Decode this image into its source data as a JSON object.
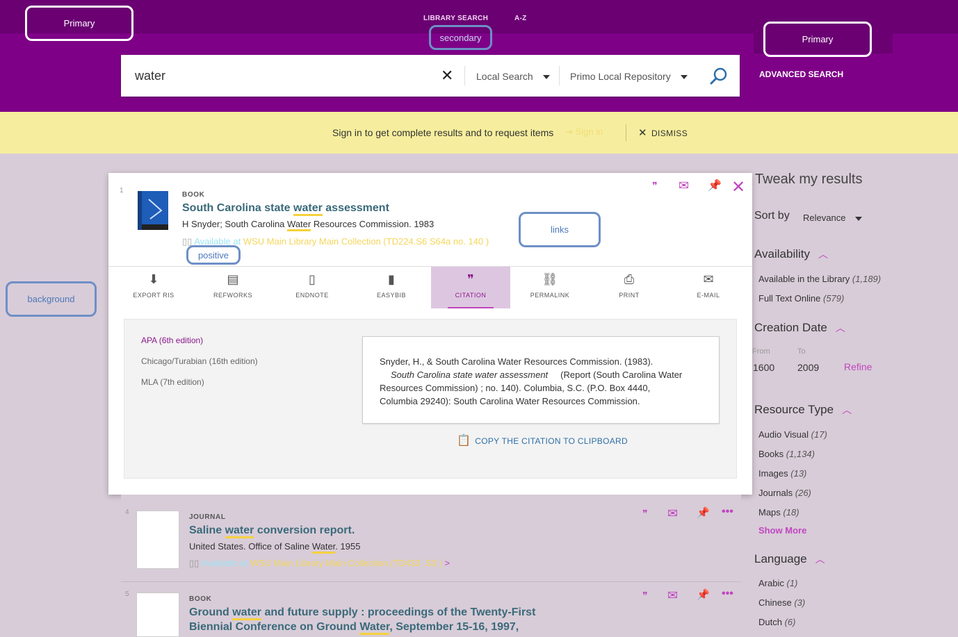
{
  "header": {
    "top_links": [
      "LIBRARY SEARCH",
      "A-Z"
    ],
    "advanced_search": "ADVANCED SEARCH"
  },
  "callouts": {
    "primary_left": "Primary",
    "secondary": "secondary",
    "primary_right": "Primary",
    "links": "links",
    "positive": "positive",
    "background": "background"
  },
  "search": {
    "query": "water",
    "scope": "Local Search",
    "tab": "Primo Local Repository"
  },
  "banner": {
    "text": "Sign in to get complete results and to request items",
    "signin": "Sign in",
    "dismiss": "DISMISS"
  },
  "record1": {
    "num": "1",
    "type": "BOOK",
    "title_pre": "South Carolina state ",
    "title_hl": "water",
    "title_post": " assessment",
    "meta_pre": "H Snyder; South Carolina ",
    "meta_hl": "Water",
    "meta_post": " Resources Commission. 1983",
    "avail_a": "Available at",
    "avail_b": "WSU Main Library Main Collection (TD224.S6 S64a no. 140 )"
  },
  "toolbar": [
    {
      "label": "EXPORT RIS",
      "icon": "export-icon"
    },
    {
      "label": "REFWORKS",
      "icon": "document-icon"
    },
    {
      "label": "ENDNOTE",
      "icon": "file-icon"
    },
    {
      "label": "EASYBIB",
      "icon": "easybib-icon"
    },
    {
      "label": "CITATION",
      "icon": "quote-icon",
      "active": true
    },
    {
      "label": "PERMALINK",
      "icon": "link-icon"
    },
    {
      "label": "PRINT",
      "icon": "print-icon"
    },
    {
      "label": "E-MAIL",
      "icon": "mail-icon"
    }
  ],
  "citation": {
    "styles": [
      "APA (6th edition)",
      "Chicago/Turabian (16th edition)",
      "MLA (7th edition)"
    ],
    "line1": "Snyder, H., & South Carolina Water Resources Commission. (1983).",
    "title_italic": "South Carolina state water assessment",
    "line2_post": "(Report (South Carolina Water",
    "line3": "Resources Commission) ; no. 140). Columbia, S.C. (P.O. Box 4440,",
    "line4": "Columbia 29240): South Carolina Water Resources Commission.",
    "copy": "COPY THE CITATION TO CLIPBOARD"
  },
  "record4": {
    "num": "4",
    "type": "JOURNAL",
    "title_pre": "Saline ",
    "title_hl": "water",
    "title_post": " conversion report.",
    "meta_pre": "United States. Office of Saline ",
    "meta_hl": "Water",
    "meta_post": ". 1955",
    "avail_a": "Available at",
    "avail_b": "WSU Main Library Main Collection (TD433 .S3 )",
    "avail_c": ">"
  },
  "record5": {
    "num": "5",
    "type": "BOOK",
    "t1_pre": "Ground ",
    "t1_hl": "water",
    "t1_post": " and future supply : proceedings of the Twenty-First",
    "t2_pre": "Biennial Conference on Ground ",
    "t2_hl": "Water",
    "t2_post": ", September 15-16, 1997,"
  },
  "sidebar": {
    "title": "Tweak my results",
    "sort_label": "Sort by",
    "sort_value": "Relevance",
    "availability": {
      "heading": "Availability",
      "items": [
        {
          "label": "Available in the Library",
          "count": "(1,189)"
        },
        {
          "label": "Full Text Online",
          "count": "(579)"
        }
      ]
    },
    "creation": {
      "heading": "Creation Date",
      "from_label": "From",
      "to_label": "To",
      "from_value": "1600",
      "to_value": "2009",
      "refine": "Refine"
    },
    "resource": {
      "heading": "Resource Type",
      "items": [
        {
          "label": "Audio Visual",
          "count": "(17)"
        },
        {
          "label": "Books",
          "count": "(1,134)"
        },
        {
          "label": "Images",
          "count": "(13)"
        },
        {
          "label": "Journals",
          "count": "(26)"
        },
        {
          "label": "Maps",
          "count": "(18)"
        }
      ],
      "show_more": "Show More"
    },
    "language": {
      "heading": "Language",
      "items": [
        {
          "label": "Arabic",
          "count": "(1)"
        },
        {
          "label": "Chinese",
          "count": "(3)"
        },
        {
          "label": "Dutch",
          "count": "(6)"
        }
      ]
    }
  }
}
